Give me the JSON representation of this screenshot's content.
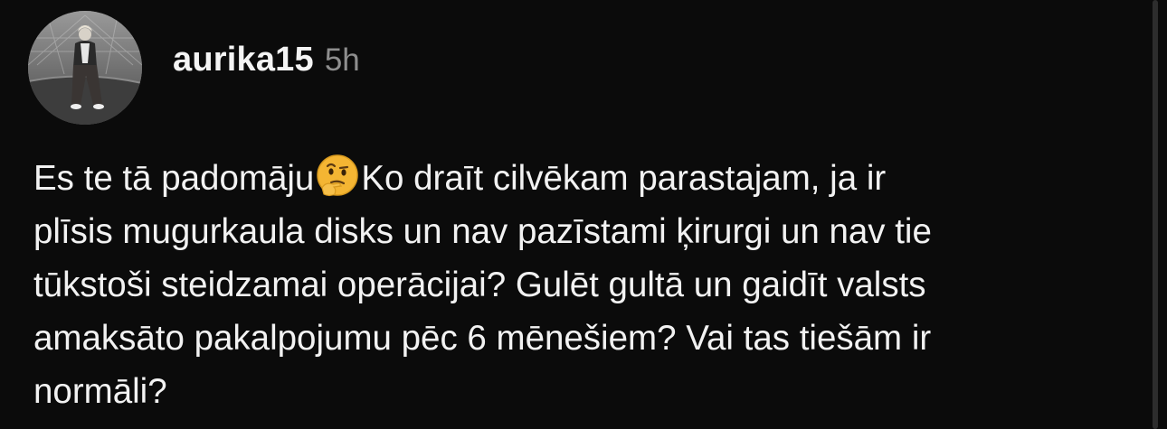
{
  "post": {
    "username": "aurika15",
    "time": "5h",
    "text_before_emoji": "Es te tā padomāju",
    "emoji": "thinking-face-emoji",
    "lines": [
      "Ko draīt cilvēkam parastajam, ja ir",
      "plīsis mugurkaula disks un nav pazīstami ķirurgi un nav tie",
      "tūkstoši steidzamai operācijai? Gulēt gultā un gaidīt valsts",
      "amaksāto pakalpojumu pēc 6 mēnešiem? Vai tas tiešām ir",
      "normāli?"
    ]
  },
  "colors": {
    "background": "#0b0b0b",
    "text": "#f2f2f2",
    "muted": "#8e8e8e",
    "emoji": "#f4b533"
  }
}
